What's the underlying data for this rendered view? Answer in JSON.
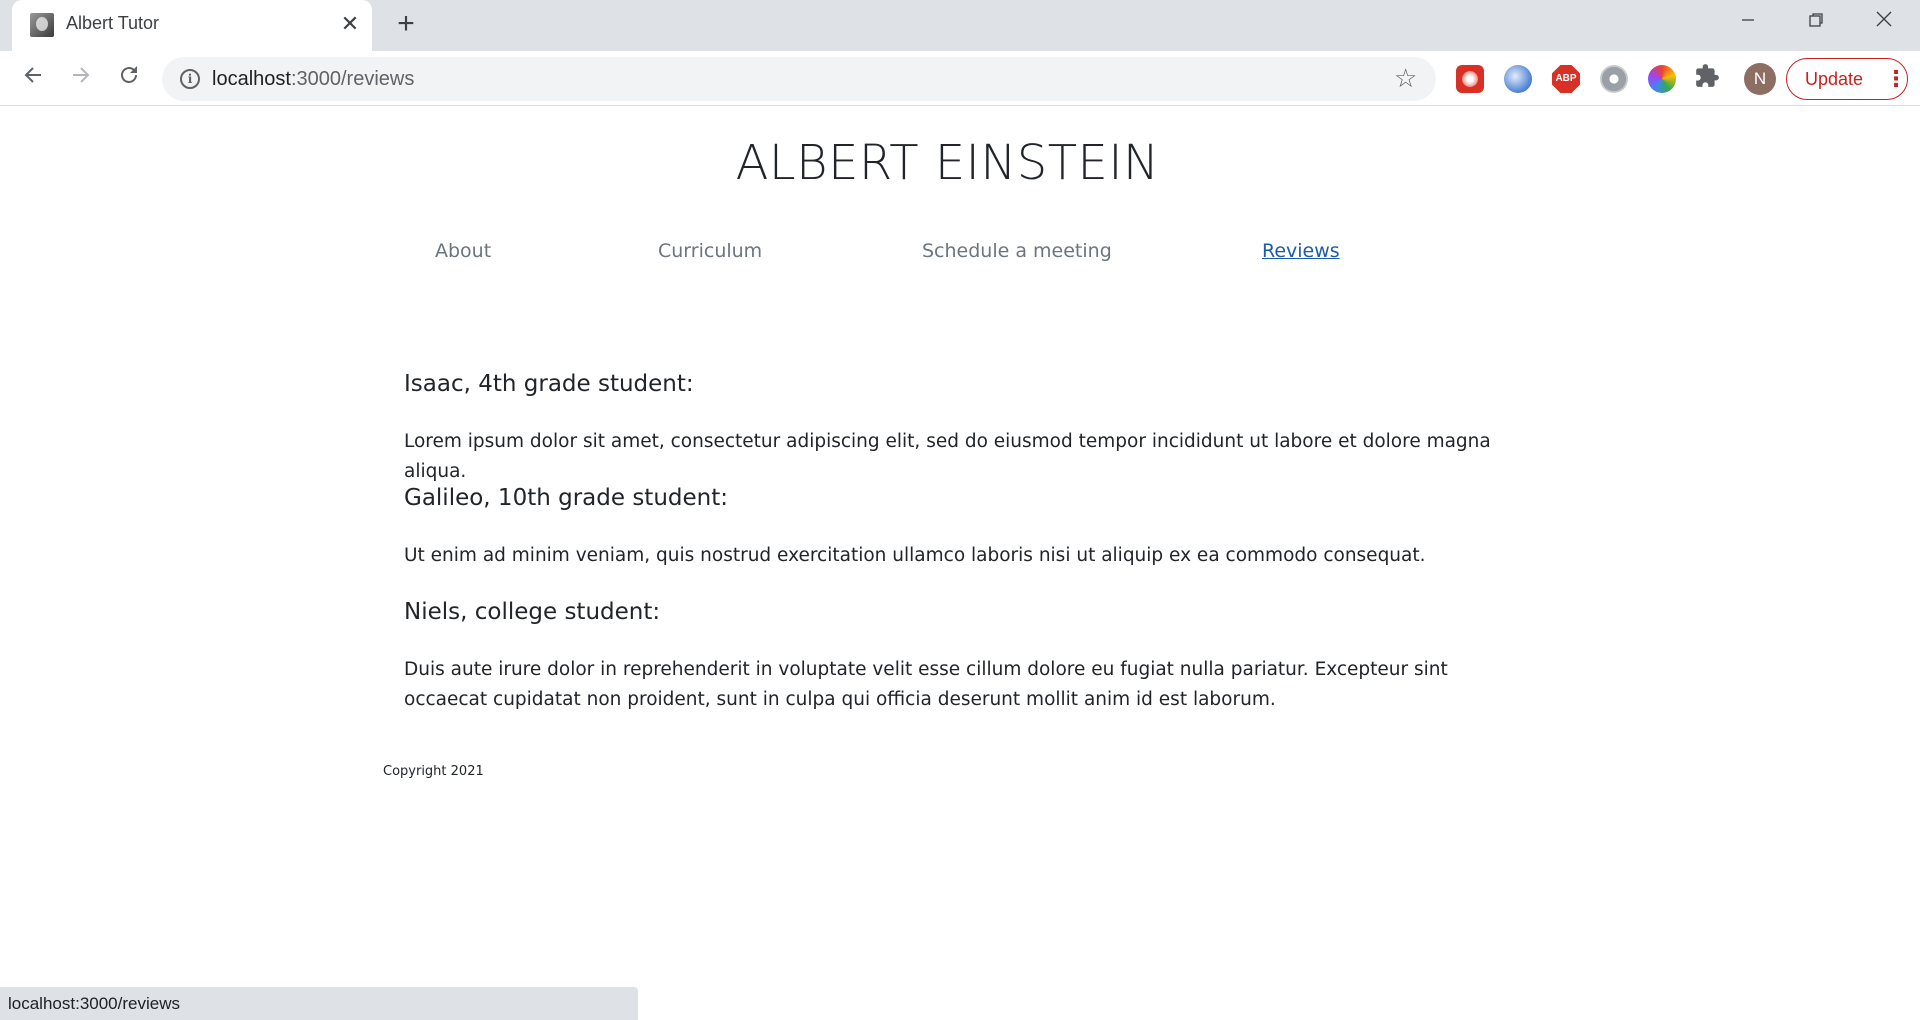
{
  "browser": {
    "tab_title": "Albert Tutor",
    "tab_close": "✕",
    "new_tab": "+",
    "url_host": "localhost",
    "url_path": ":3000/reviews",
    "profile_initial": "N",
    "update_label": "Update",
    "ext_abp_label": "ABP",
    "icons": [
      "back-arrow-icon",
      "forward-arrow-icon",
      "reload-icon",
      "info-icon",
      "star-icon",
      "puzzle-icon",
      "more-vert-icon",
      "minimize-icon",
      "restore-icon",
      "close-icon"
    ]
  },
  "site": {
    "title": "ALBERT EINSTEIN",
    "nav": {
      "about": "About",
      "curriculum": "Curriculum",
      "schedule": "Schedule a meeting",
      "reviews": "Reviews"
    },
    "active_nav": "Reviews",
    "active_color": "#1a5ca8"
  },
  "reviews": [
    {
      "name": "Isaac, 4th grade student:",
      "text": "Lorem ipsum dolor sit amet, consectetur adipiscing elit, sed do eiusmod tempor incididunt ut labore et dolore magna aliqua."
    },
    {
      "name": "Galileo, 10th grade student:",
      "text": "Ut enim ad minim veniam, quis nostrud exercitation ullamco laboris nisi ut aliquip ex ea commodo consequat."
    },
    {
      "name": "Niels, college student:",
      "text": "Duis aute irure dolor in reprehenderit in voluptate velit esse cillum dolore eu fugiat nulla pariatur. Excepteur sint occaecat cupidatat non proident, sunt in culpa qui officia deserunt mollit anim id est laborum."
    }
  ],
  "footer": {
    "copyright": "Copyright 2021"
  },
  "status_bar": {
    "text": "localhost:3000/reviews"
  }
}
